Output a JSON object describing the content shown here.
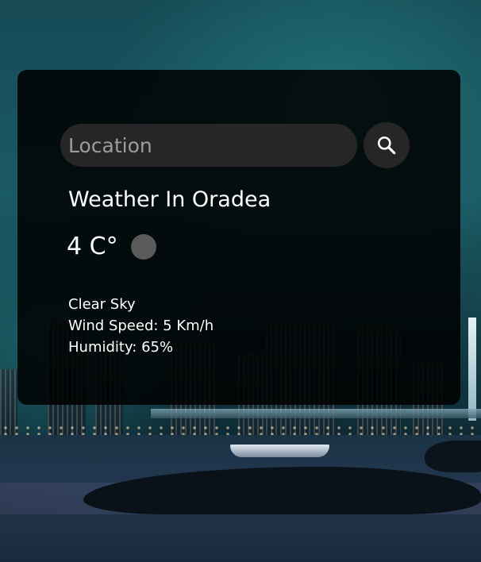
{
  "search": {
    "placeholder": "Location",
    "button_icon": "search-icon"
  },
  "weather": {
    "title": "Weather In Oradea",
    "temperature": "4 C°",
    "icon": "weather-condition-icon",
    "description": "Clear Sky",
    "wind": "Wind Speed: 5 Km/h",
    "humidity": "Humidity: 65%"
  },
  "colors": {
    "card_background": "#000000",
    "input_background": "#262626",
    "text": "#ffffff",
    "placeholder": "#9c9c9c"
  }
}
